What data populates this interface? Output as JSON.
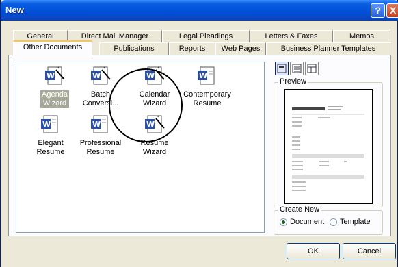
{
  "window": {
    "title": "New"
  },
  "titlebar": {
    "help_label": "?",
    "close_label": "X"
  },
  "tabs_row1": [
    "General",
    "Direct Mail Manager",
    "Legal Pleadings",
    "Letters & Faxes",
    "Memos"
  ],
  "tabs_row2": [
    "Other Documents",
    "Publications",
    "Reports",
    "Web Pages",
    "Business Planner Templates"
  ],
  "active_tab": "Other Documents",
  "documents": [
    {
      "label": "Agenda Wizard",
      "line1": "Agenda",
      "line2": "Wizard",
      "type": "wizard",
      "selected": true
    },
    {
      "label": "Batch Conversion Wizard",
      "line1": "Batch",
      "line2": "Conversi...",
      "type": "wizard",
      "selected": false
    },
    {
      "label": "Calendar Wizard",
      "line1": "Calendar",
      "line2": "Wizard",
      "type": "wizard",
      "selected": false
    },
    {
      "label": "Contemporary Resume",
      "line1": "Contemporary",
      "line2": "Resume",
      "type": "template",
      "selected": false
    },
    {
      "label": "Elegant Resume",
      "line1": "Elegant",
      "line2": "Resume",
      "type": "template",
      "selected": false
    },
    {
      "label": "Professional Resume",
      "line1": "Professional",
      "line2": "Resume",
      "type": "template",
      "selected": false
    },
    {
      "label": "Resume Wizard",
      "line1": "Resume",
      "line2": "Wizard",
      "type": "wizard",
      "selected": false
    }
  ],
  "preview": {
    "label": "Preview"
  },
  "create_new": {
    "label": "Create New",
    "document_label": "Document",
    "template_label": "Template",
    "selected": "Document"
  },
  "buttons": {
    "ok": "OK",
    "cancel": "Cancel"
  },
  "colors": {
    "title_bar": "#0050d8",
    "dialog_bg": "#ece9d8",
    "active_tab_accent": "#ffc73c",
    "word_icon_blue": "#2a4fa8"
  }
}
